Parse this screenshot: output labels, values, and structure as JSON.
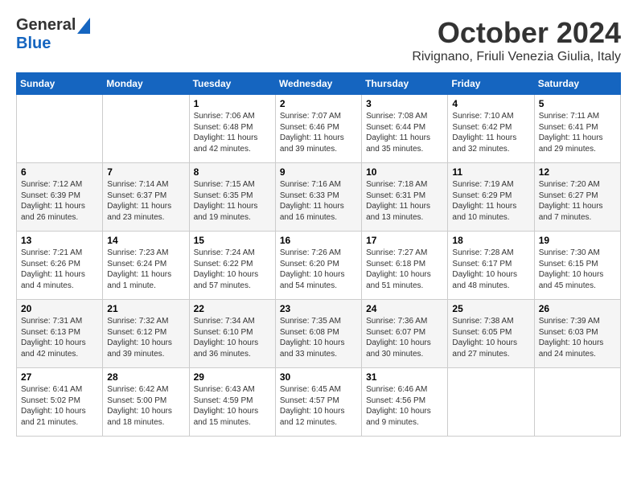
{
  "header": {
    "logo_line1": "General",
    "logo_line2": "Blue",
    "month_title": "October 2024",
    "location": "Rivignano, Friuli Venezia Giulia, Italy"
  },
  "days_of_week": [
    "Sunday",
    "Monday",
    "Tuesday",
    "Wednesday",
    "Thursday",
    "Friday",
    "Saturday"
  ],
  "weeks": [
    [
      {
        "day": "",
        "info": ""
      },
      {
        "day": "",
        "info": ""
      },
      {
        "day": "1",
        "info": "Sunrise: 7:06 AM\nSunset: 6:48 PM\nDaylight: 11 hours and 42 minutes."
      },
      {
        "day": "2",
        "info": "Sunrise: 7:07 AM\nSunset: 6:46 PM\nDaylight: 11 hours and 39 minutes."
      },
      {
        "day": "3",
        "info": "Sunrise: 7:08 AM\nSunset: 6:44 PM\nDaylight: 11 hours and 35 minutes."
      },
      {
        "day": "4",
        "info": "Sunrise: 7:10 AM\nSunset: 6:42 PM\nDaylight: 11 hours and 32 minutes."
      },
      {
        "day": "5",
        "info": "Sunrise: 7:11 AM\nSunset: 6:41 PM\nDaylight: 11 hours and 29 minutes."
      }
    ],
    [
      {
        "day": "6",
        "info": "Sunrise: 7:12 AM\nSunset: 6:39 PM\nDaylight: 11 hours and 26 minutes."
      },
      {
        "day": "7",
        "info": "Sunrise: 7:14 AM\nSunset: 6:37 PM\nDaylight: 11 hours and 23 minutes."
      },
      {
        "day": "8",
        "info": "Sunrise: 7:15 AM\nSunset: 6:35 PM\nDaylight: 11 hours and 19 minutes."
      },
      {
        "day": "9",
        "info": "Sunrise: 7:16 AM\nSunset: 6:33 PM\nDaylight: 11 hours and 16 minutes."
      },
      {
        "day": "10",
        "info": "Sunrise: 7:18 AM\nSunset: 6:31 PM\nDaylight: 11 hours and 13 minutes."
      },
      {
        "day": "11",
        "info": "Sunrise: 7:19 AM\nSunset: 6:29 PM\nDaylight: 11 hours and 10 minutes."
      },
      {
        "day": "12",
        "info": "Sunrise: 7:20 AM\nSunset: 6:27 PM\nDaylight: 11 hours and 7 minutes."
      }
    ],
    [
      {
        "day": "13",
        "info": "Sunrise: 7:21 AM\nSunset: 6:26 PM\nDaylight: 11 hours and 4 minutes."
      },
      {
        "day": "14",
        "info": "Sunrise: 7:23 AM\nSunset: 6:24 PM\nDaylight: 11 hours and 1 minute."
      },
      {
        "day": "15",
        "info": "Sunrise: 7:24 AM\nSunset: 6:22 PM\nDaylight: 10 hours and 57 minutes."
      },
      {
        "day": "16",
        "info": "Sunrise: 7:26 AM\nSunset: 6:20 PM\nDaylight: 10 hours and 54 minutes."
      },
      {
        "day": "17",
        "info": "Sunrise: 7:27 AM\nSunset: 6:18 PM\nDaylight: 10 hours and 51 minutes."
      },
      {
        "day": "18",
        "info": "Sunrise: 7:28 AM\nSunset: 6:17 PM\nDaylight: 10 hours and 48 minutes."
      },
      {
        "day": "19",
        "info": "Sunrise: 7:30 AM\nSunset: 6:15 PM\nDaylight: 10 hours and 45 minutes."
      }
    ],
    [
      {
        "day": "20",
        "info": "Sunrise: 7:31 AM\nSunset: 6:13 PM\nDaylight: 10 hours and 42 minutes."
      },
      {
        "day": "21",
        "info": "Sunrise: 7:32 AM\nSunset: 6:12 PM\nDaylight: 10 hours and 39 minutes."
      },
      {
        "day": "22",
        "info": "Sunrise: 7:34 AM\nSunset: 6:10 PM\nDaylight: 10 hours and 36 minutes."
      },
      {
        "day": "23",
        "info": "Sunrise: 7:35 AM\nSunset: 6:08 PM\nDaylight: 10 hours and 33 minutes."
      },
      {
        "day": "24",
        "info": "Sunrise: 7:36 AM\nSunset: 6:07 PM\nDaylight: 10 hours and 30 minutes."
      },
      {
        "day": "25",
        "info": "Sunrise: 7:38 AM\nSunset: 6:05 PM\nDaylight: 10 hours and 27 minutes."
      },
      {
        "day": "26",
        "info": "Sunrise: 7:39 AM\nSunset: 6:03 PM\nDaylight: 10 hours and 24 minutes."
      }
    ],
    [
      {
        "day": "27",
        "info": "Sunrise: 6:41 AM\nSunset: 5:02 PM\nDaylight: 10 hours and 21 minutes."
      },
      {
        "day": "28",
        "info": "Sunrise: 6:42 AM\nSunset: 5:00 PM\nDaylight: 10 hours and 18 minutes."
      },
      {
        "day": "29",
        "info": "Sunrise: 6:43 AM\nSunset: 4:59 PM\nDaylight: 10 hours and 15 minutes."
      },
      {
        "day": "30",
        "info": "Sunrise: 6:45 AM\nSunset: 4:57 PM\nDaylight: 10 hours and 12 minutes."
      },
      {
        "day": "31",
        "info": "Sunrise: 6:46 AM\nSunset: 4:56 PM\nDaylight: 10 hours and 9 minutes."
      },
      {
        "day": "",
        "info": ""
      },
      {
        "day": "",
        "info": ""
      }
    ]
  ]
}
